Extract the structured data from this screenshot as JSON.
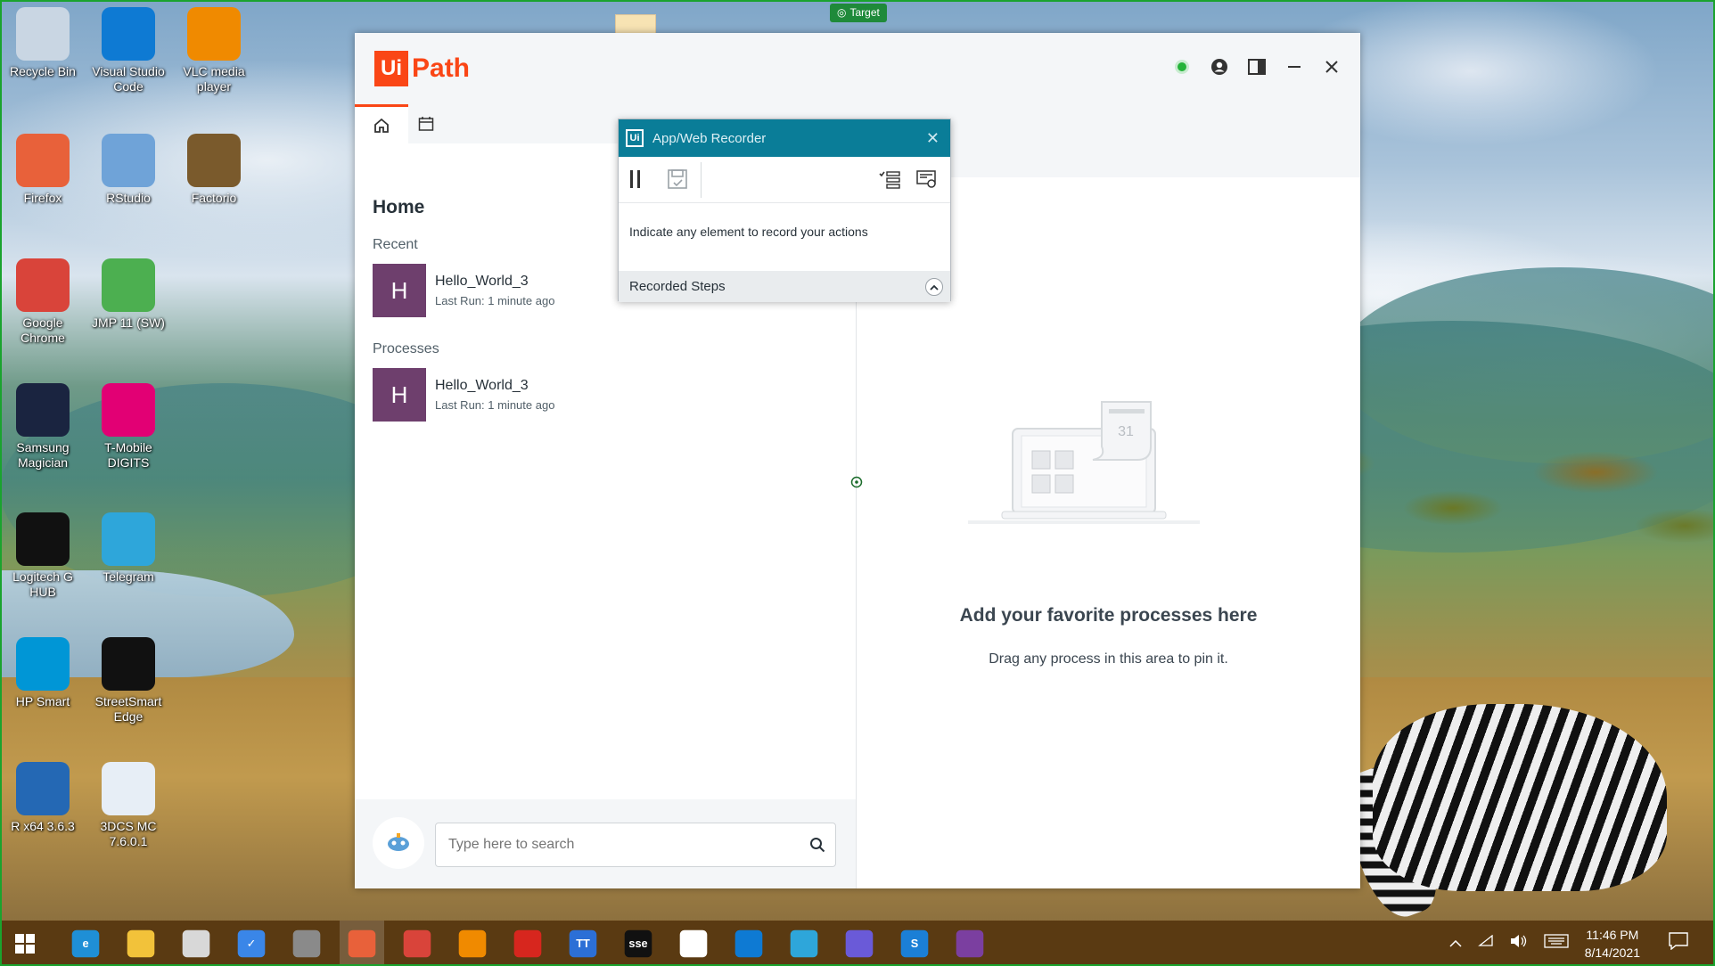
{
  "target_badge": "Target",
  "desktop_icons": [
    {
      "label": "Recycle Bin",
      "icon": "recycle-bin-icon",
      "color": "#c9d6e3"
    },
    {
      "label": "Visual Studio Code",
      "icon": "vscode-icon",
      "color": "#0e7ad3"
    },
    {
      "label": "VLC media player",
      "icon": "vlc-icon",
      "color": "#f08a00"
    },
    {
      "label": "Firefox",
      "icon": "firefox-icon",
      "color": "#e8613a"
    },
    {
      "label": "RStudio",
      "icon": "rstudio-icon",
      "color": "#6fa3d8"
    },
    {
      "label": "Factorio",
      "icon": "factorio-icon",
      "color": "#7a5a2c"
    },
    {
      "label": "Google Chrome",
      "icon": "chrome-icon",
      "color": "#d9443a"
    },
    {
      "label": "JMP 11 (SW)",
      "icon": "jmp-icon",
      "color": "#4caf50"
    },
    {
      "label": "Samsung Magician",
      "icon": "samsung-magician-icon",
      "color": "#1a2440"
    },
    {
      "label": "T-Mobile DIGITS",
      "icon": "tmobile-icon",
      "color": "#e20074"
    },
    {
      "label": "Logitech G HUB",
      "icon": "logitech-icon",
      "color": "#111111"
    },
    {
      "label": "Telegram",
      "icon": "telegram-icon",
      "color": "#2ea6da"
    },
    {
      "label": "HP Smart",
      "icon": "hp-smart-icon",
      "color": "#0096d6"
    },
    {
      "label": "StreetSmart Edge",
      "icon": "streetsmart-icon",
      "color": "#111111"
    },
    {
      "label": "R x64 3.6.3",
      "icon": "r-icon",
      "color": "#2468b4"
    },
    {
      "label": "3DCS MC 7.6.0.1",
      "icon": "3dcs-icon",
      "color": "#e7eef6"
    }
  ],
  "uipath": {
    "logo_ui": "Ui",
    "logo_path": "Path",
    "home_title": "Home",
    "recent_label": "Recent",
    "processes_label": "Processes",
    "recent": [
      {
        "avatar": "H",
        "name": "Hello_World_3",
        "meta": "Last Run: 1 minute ago"
      }
    ],
    "processes": [
      {
        "avatar": "H",
        "name": "Hello_World_3",
        "meta": "Last Run: 1 minute ago"
      }
    ],
    "search_placeholder": "Type here to search",
    "fav_title": "Add your favorite processes here",
    "fav_sub": "Drag any process in this area to pin it.",
    "calendar_day": "31"
  },
  "recorder": {
    "title": "App/Web Recorder",
    "logo": "Ui",
    "message": "Indicate any element to record your actions",
    "steps_label": "Recorded Steps"
  },
  "taskbar": {
    "time": "11:46 PM",
    "date": "8/14/2021",
    "apps": [
      {
        "icon": "edge-icon",
        "color": "#1f8fd6",
        "text": "e"
      },
      {
        "icon": "file-explorer-icon",
        "color": "#f2c23a",
        "text": ""
      },
      {
        "icon": "snip-icon",
        "color": "#d8d8d8",
        "text": ""
      },
      {
        "icon": "todo-icon",
        "color": "#3a86e8",
        "text": "✓"
      },
      {
        "icon": "usb-icon",
        "color": "#8a8a8a",
        "text": ""
      },
      {
        "icon": "firefox-icon",
        "color": "#e8613a",
        "text": ""
      },
      {
        "icon": "chrome-icon",
        "color": "#d9443a",
        "text": ""
      },
      {
        "icon": "vlc-icon",
        "color": "#f08a00",
        "text": ""
      },
      {
        "icon": "acrobat-icon",
        "color": "#d7261e",
        "text": ""
      },
      {
        "icon": "teams-icon",
        "color": "#2c6fd6",
        "text": "TT"
      },
      {
        "icon": "streetsmart-icon",
        "color": "#111111",
        "text": "sse"
      },
      {
        "icon": "acrobat-sign-icon",
        "color": "#ffffff",
        "text": ""
      },
      {
        "icon": "vscode-icon",
        "color": "#0e7ad3",
        "text": ""
      },
      {
        "icon": "telegram-icon",
        "color": "#2ea6da",
        "text": ""
      },
      {
        "icon": "chrome-settings-icon",
        "color": "#6a5ad8",
        "text": ""
      },
      {
        "icon": "uipath-studio-icon",
        "color": "#1b7fd6",
        "text": "S"
      },
      {
        "icon": "uipath-assistant-icon",
        "color": "#7b3fa0",
        "text": ""
      }
    ]
  }
}
